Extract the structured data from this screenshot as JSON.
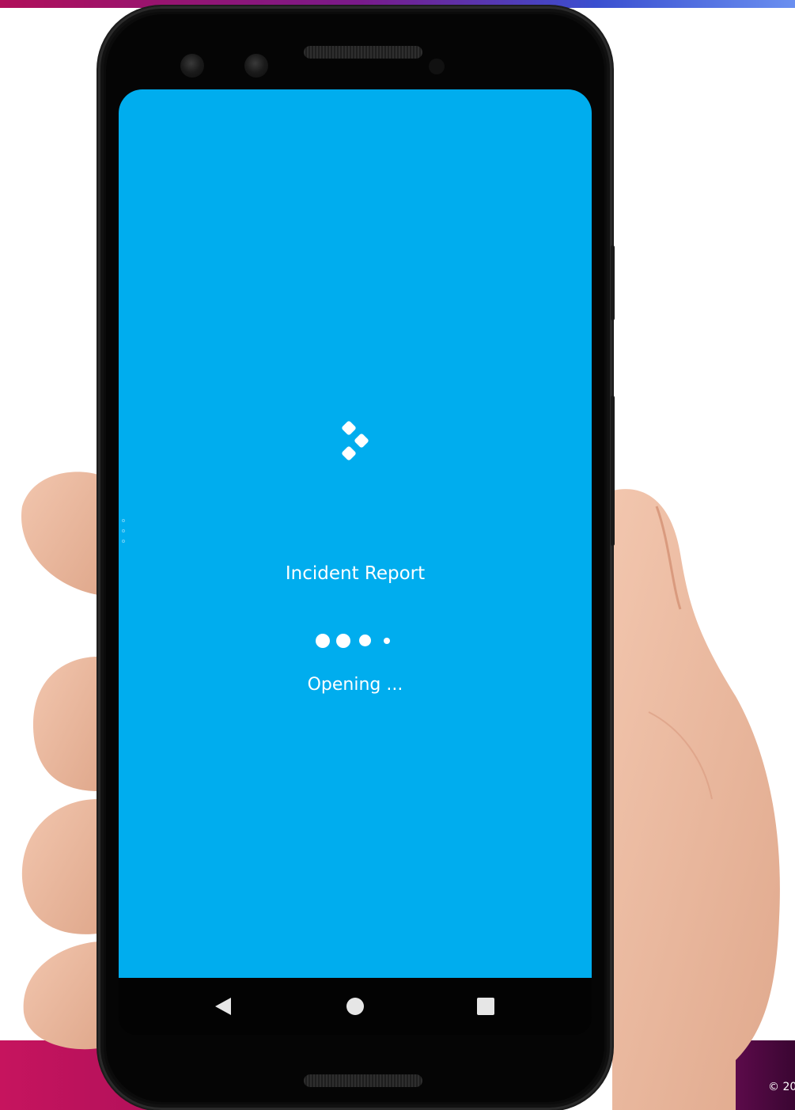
{
  "background": {
    "top_strip_colors": [
      "#b0105a",
      "#3a4fd0",
      "#6a8ff0"
    ],
    "band_left_color": "#c6145e",
    "band_right_color": "#4a0840",
    "copyright_text": "© 20"
  },
  "device": {
    "type": "android-phone",
    "frame_color": "#0b0b0b"
  },
  "screen": {
    "background_color": "#00adee",
    "app_title": "Incident Report",
    "status_text": "Opening ...",
    "loading_dots": 4,
    "logo_icon": "power-apps-logo-icon"
  },
  "navigation_bar": {
    "buttons": [
      {
        "name": "back",
        "icon": "back-triangle-icon"
      },
      {
        "name": "home",
        "icon": "home-circle-icon"
      },
      {
        "name": "recents",
        "icon": "recents-square-icon"
      }
    ]
  }
}
